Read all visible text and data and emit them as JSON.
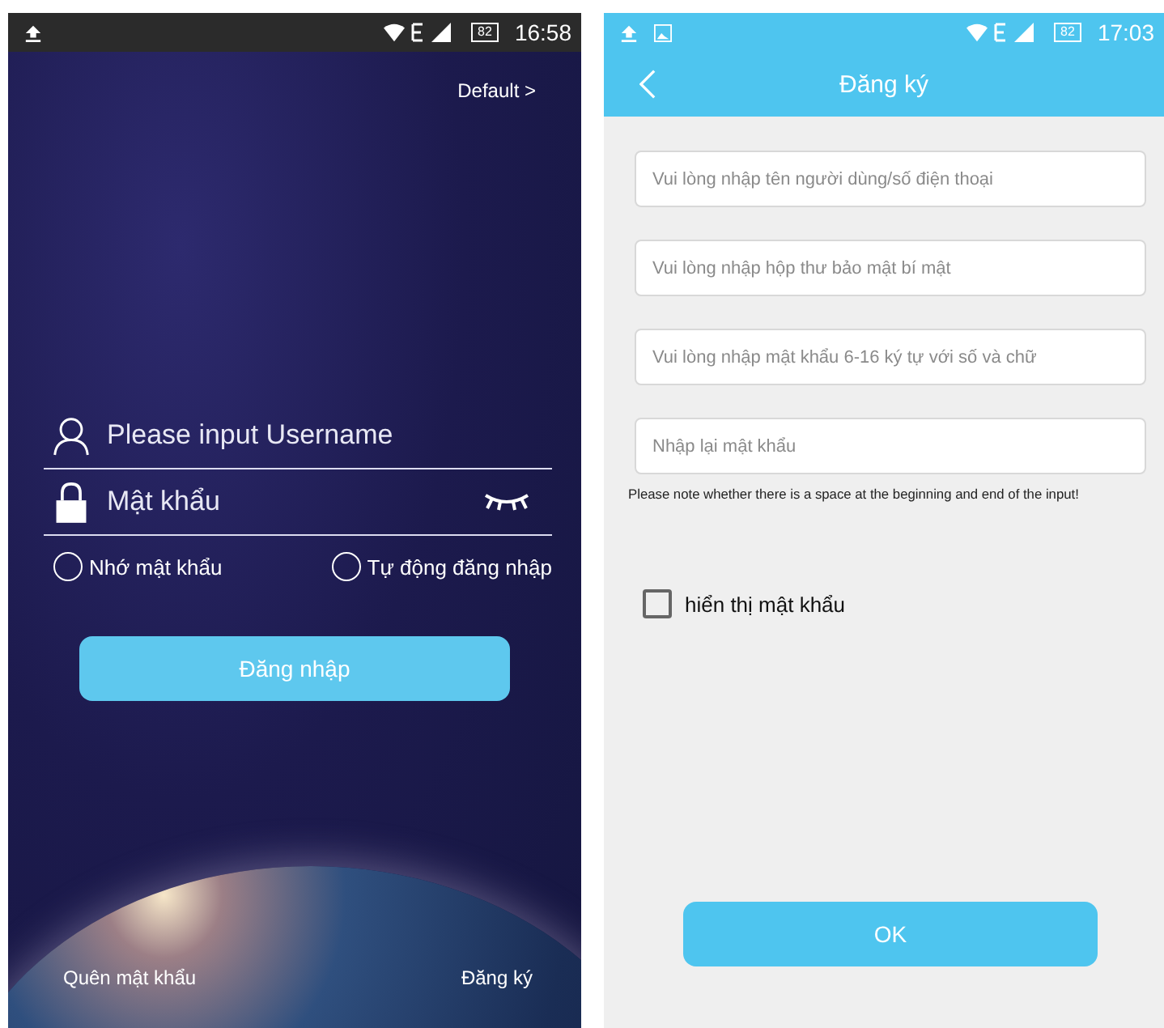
{
  "login_screen": {
    "status_bar": {
      "battery": "82",
      "time": "16:58"
    },
    "server_link": "Default >",
    "username_field": {
      "placeholder": "Please input Username"
    },
    "password_field": {
      "placeholder": "Mật khẩu"
    },
    "options": [
      {
        "label": "Nhớ mật khẩu",
        "checked": false
      },
      {
        "label": "Tự động đăng nhập",
        "checked": false
      }
    ],
    "login_button": "Đăng nhập",
    "forgot_link": "Quên mật khẩu",
    "register_link": "Đăng ký"
  },
  "register_screen": {
    "status_bar": {
      "battery": "82",
      "time": "17:03"
    },
    "title": "Đăng ký",
    "fields": [
      {
        "placeholder": "Vui lòng nhập tên người dùng/số điện thoại"
      },
      {
        "placeholder": "Vui lòng nhập hộp thư bảo mật bí mật"
      },
      {
        "placeholder": "Vui lòng nhập mật khẩu 6-16 ký tự với số và chữ"
      },
      {
        "placeholder": "Nhập lại mật khẩu"
      }
    ],
    "note": "Please note whether there is a space at the beginning and end of the input!",
    "show_password": {
      "label": "hiển thị mật khẩu",
      "checked": false
    },
    "ok_button": "OK"
  }
}
